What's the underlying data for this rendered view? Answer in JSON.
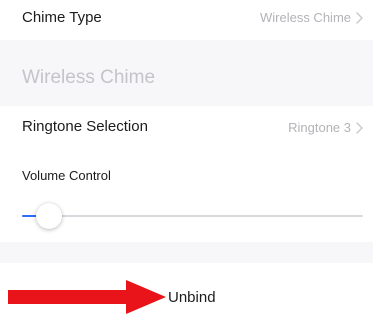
{
  "chime_type": {
    "label": "Chime Type",
    "value": "Wireless Chime"
  },
  "section": {
    "title": "Wireless Chime"
  },
  "ringtone": {
    "label": "Ringtone Selection",
    "value": "Ringtone 3"
  },
  "volume": {
    "label": "Volume Control",
    "level": 0.08
  },
  "unbind": {
    "label": "Unbind"
  },
  "colors": {
    "background": "#f7f7f9",
    "row_background": "#ffffff",
    "value_text": "#b3b3b8",
    "section_title": "#c4c4c9",
    "slider_fill": "#2f6bff",
    "annotation_arrow": "#e8141a"
  },
  "icons": {
    "chevron": "chevron-right-icon",
    "annotation": "red-arrow-icon"
  }
}
